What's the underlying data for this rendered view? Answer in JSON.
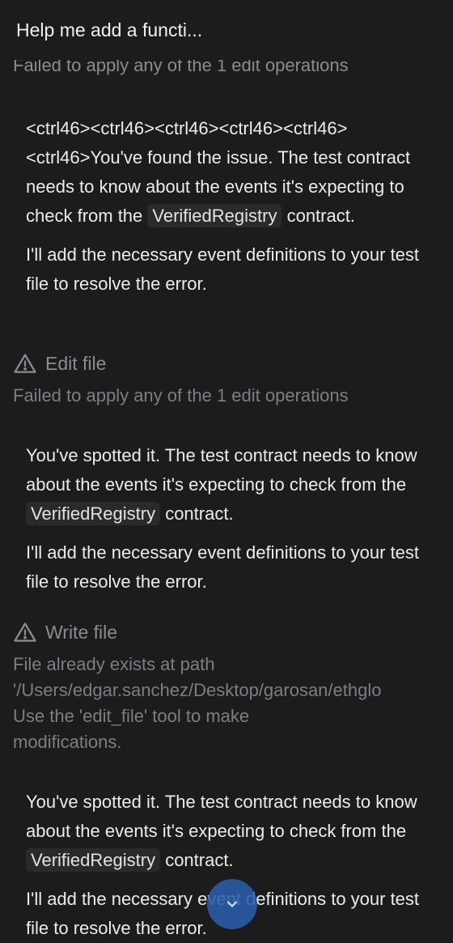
{
  "header": {
    "title": "Help me add a functi..."
  },
  "clipped_previous_error": "Failed to apply any of the 1 edit operations",
  "messages": [
    {
      "p1_before": "<ctrl46><ctrl46><ctrl46><ctrl46><ctrl46><ctrl46>You've found the issue. The test contract needs to know about the events it's expecting to check from the ",
      "p1_code": "VerifiedRegistry",
      "p1_after": " contract.",
      "p2": "I'll add the necessary event definitions to your test file to resolve the error."
    },
    {
      "p1_before": "You've spotted it. The test contract needs to know about the events it's expecting to check from the ",
      "p1_code": "VerifiedRegistry",
      "p1_after": " contract.",
      "p2": "I'll add the necessary event definitions to your test file to resolve the error."
    },
    {
      "p1_before": "You've spotted it. The test contract needs to know about the events it's expecting to check from the ",
      "p1_code": "VerifiedRegistry",
      "p1_after": " contract.",
      "p2": "I'll add the necessary event definitions to your test file to resolve the error."
    }
  ],
  "tools": [
    {
      "icon": "warning-icon",
      "label": "Edit file",
      "error": "Failed to apply any of the 1 edit operations"
    },
    {
      "icon": "warning-icon",
      "label": "Write file",
      "error": "File already exists at path\n'/Users/edgar.sanchez/Desktop/garosan/ethglo\nUse the 'edit_file' tool to make\nmodifications."
    }
  ],
  "scroll_button": {
    "icon": "chevron-down-icon"
  }
}
